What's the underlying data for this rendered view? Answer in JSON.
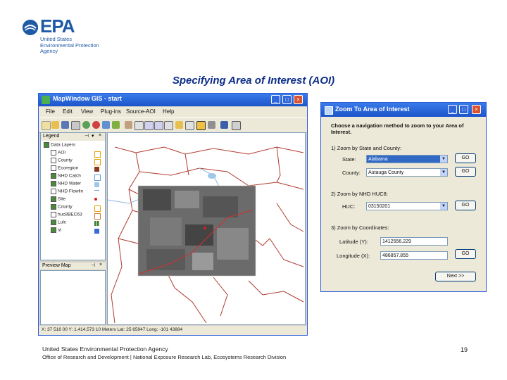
{
  "logo": {
    "wordmark": "EPA",
    "subtitle": "United States\nEnvironmental Protection\nAgency"
  },
  "slide_title": "Specifying Area of Interest (AOI)",
  "mapwindow": {
    "title": "MapWindow GIS  - start",
    "menu": [
      "File",
      "Edit",
      "View",
      "Plug-ins",
      "Source-AOI",
      "Help"
    ],
    "legend_header": "Legend",
    "layers": [
      {
        "label": "Data Layers",
        "checked": true,
        "swatch": ""
      },
      {
        "label": "AOI",
        "checked": false,
        "swatch": "#e8a000"
      },
      {
        "label": "County",
        "checked": false,
        "swatch": "#e8a000"
      },
      {
        "label": "Ecoregion",
        "checked": false,
        "swatch": "#8b3a1a"
      },
      {
        "label": "NHD Catch",
        "checked": true,
        "swatch": "#6aa0d8"
      },
      {
        "label": "NHD Water",
        "checked": true,
        "swatch": "#9ec8e8"
      },
      {
        "label": "NHD Flowlin",
        "checked": false,
        "swatch": "#6aa0d8"
      },
      {
        "label": "Site",
        "checked": true,
        "swatch": "#d81e1e"
      },
      {
        "label": "County",
        "checked": true,
        "swatch": "#e8a000"
      },
      {
        "label": "huc8BEC63",
        "checked": false,
        "swatch": "#cc7a33"
      },
      {
        "label": "Lulc",
        "checked": true,
        "swatch": "#3b7a3b"
      },
      {
        "label": "st",
        "checked": true,
        "swatch": "#3a6ad8"
      }
    ],
    "preview_label": "Preview Map",
    "status_text": "X: 37 516 00     Y: 1,414,573 10 Meters     Lat: 25 65947     Long: -101 43884"
  },
  "zoom_dialog": {
    "title": "Zoom To Area of Interest",
    "instruction": "Choose a navigation method to zoom to your Area of Interest.",
    "section1": "1) Zoom by State and County:",
    "state_label": "State:",
    "state_value": "Alabama",
    "county_label": "County:",
    "county_value": "Autauga County",
    "button_label": "GO",
    "section2": "2) Zoom by NHD HUC8:",
    "huc_label": "HUC:",
    "huc_value": "03150201",
    "section3": "3) Zoom by Coordinates:",
    "lat_label": "Latitude (Y):",
    "lat_value": "1412556.229",
    "long_label": "Longitude (X):",
    "long_value": "486857.855",
    "next_label": "Next >>"
  },
  "footer": {
    "org": "United States Environmental Protection Agency",
    "office": "Office of Research and Development | National Exposure Research Lab, Ecosystems Research Division",
    "page_number": "19"
  }
}
